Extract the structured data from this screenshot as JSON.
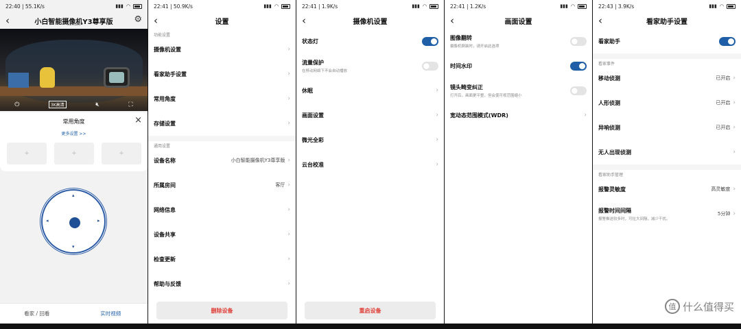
{
  "accent": "#1f5fa8",
  "danger": "#e0413a",
  "screens": [
    {
      "status": {
        "time": "22:40 | 55.1K/s",
        "battery": "battery-icon"
      },
      "title": "小白智能摄像机Y3尊享版",
      "subtitle": "62KB/S",
      "camera_controls": {
        "quality": "3K高清"
      },
      "angles": {
        "title": "常用角度",
        "more": "更多设置 >>"
      },
      "tabs": {
        "playback": "看家 / 回看",
        "live": "实时视频"
      }
    },
    {
      "status": {
        "time": "22:41 | 50.9K/s"
      },
      "title": "设置",
      "section1": "功能设置",
      "section2": "通用设置",
      "rows": [
        {
          "label": "摄像机设置",
          "value": ""
        },
        {
          "label": "看家助手设置",
          "value": ""
        },
        {
          "label": "常用角度",
          "value": ""
        },
        {
          "label": "存储设置",
          "value": ""
        },
        {
          "label": "设备名称",
          "value": "小白智能摄像机Y3尊享版"
        },
        {
          "label": "所属房间",
          "value": "客厅"
        },
        {
          "label": "网络信息",
          "value": ""
        },
        {
          "label": "设备共享",
          "value": ""
        },
        {
          "label": "检查更新",
          "value": ""
        },
        {
          "label": "帮助与反馈",
          "value": ""
        }
      ],
      "button": "删除设备"
    },
    {
      "status": {
        "time": "22:41 | 1.9K/s"
      },
      "title": "摄像机设置",
      "rows": [
        {
          "label": "状态灯",
          "sub": "",
          "toggle": true
        },
        {
          "label": "流量保护",
          "sub": "在移动网络下不会自动播放",
          "toggle": false
        },
        {
          "label": "休眠",
          "sub": ""
        },
        {
          "label": "画面设置",
          "sub": ""
        },
        {
          "label": "微光全彩",
          "sub": ""
        },
        {
          "label": "云台校准",
          "sub": ""
        }
      ],
      "button": "重启设备"
    },
    {
      "status": {
        "time": "22:41 | 1.2K/s"
      },
      "title": "画面设置",
      "rows": [
        {
          "label": "图像翻转",
          "sub": "摄像机倒装时，请开启此选项",
          "toggle": false
        },
        {
          "label": "时间水印",
          "sub": "",
          "toggle": true
        },
        {
          "label": "镜头畸变纠正",
          "sub": "打开后，画面更平整，但会使可视范围缩小",
          "toggle": false
        },
        {
          "label": "宽动态范围模式(WDR)",
          "sub": ""
        }
      ]
    },
    {
      "status": {
        "time": "22:43 | 3.9K/s"
      },
      "title": "看家助手设置",
      "main": {
        "label": "看家助手",
        "toggle": true
      },
      "section1": "看家事件",
      "section2": "看家助手管理",
      "events": [
        {
          "label": "移动侦测",
          "value": "已开启"
        },
        {
          "label": "人形侦测",
          "value": "已开启"
        },
        {
          "label": "异响侦测",
          "value": "已开启"
        },
        {
          "label": "无人出现侦测",
          "value": ""
        }
      ],
      "manage": [
        {
          "label": "报警灵敏度",
          "value": "高灵敏度",
          "sub": ""
        },
        {
          "label": "报警时间间隔",
          "value": "5分钟",
          "sub": "报警推送较多时，可拉大间隔，减少干扰。"
        }
      ]
    }
  ],
  "watermark": {
    "logo": "值",
    "text": "什么值得买"
  }
}
